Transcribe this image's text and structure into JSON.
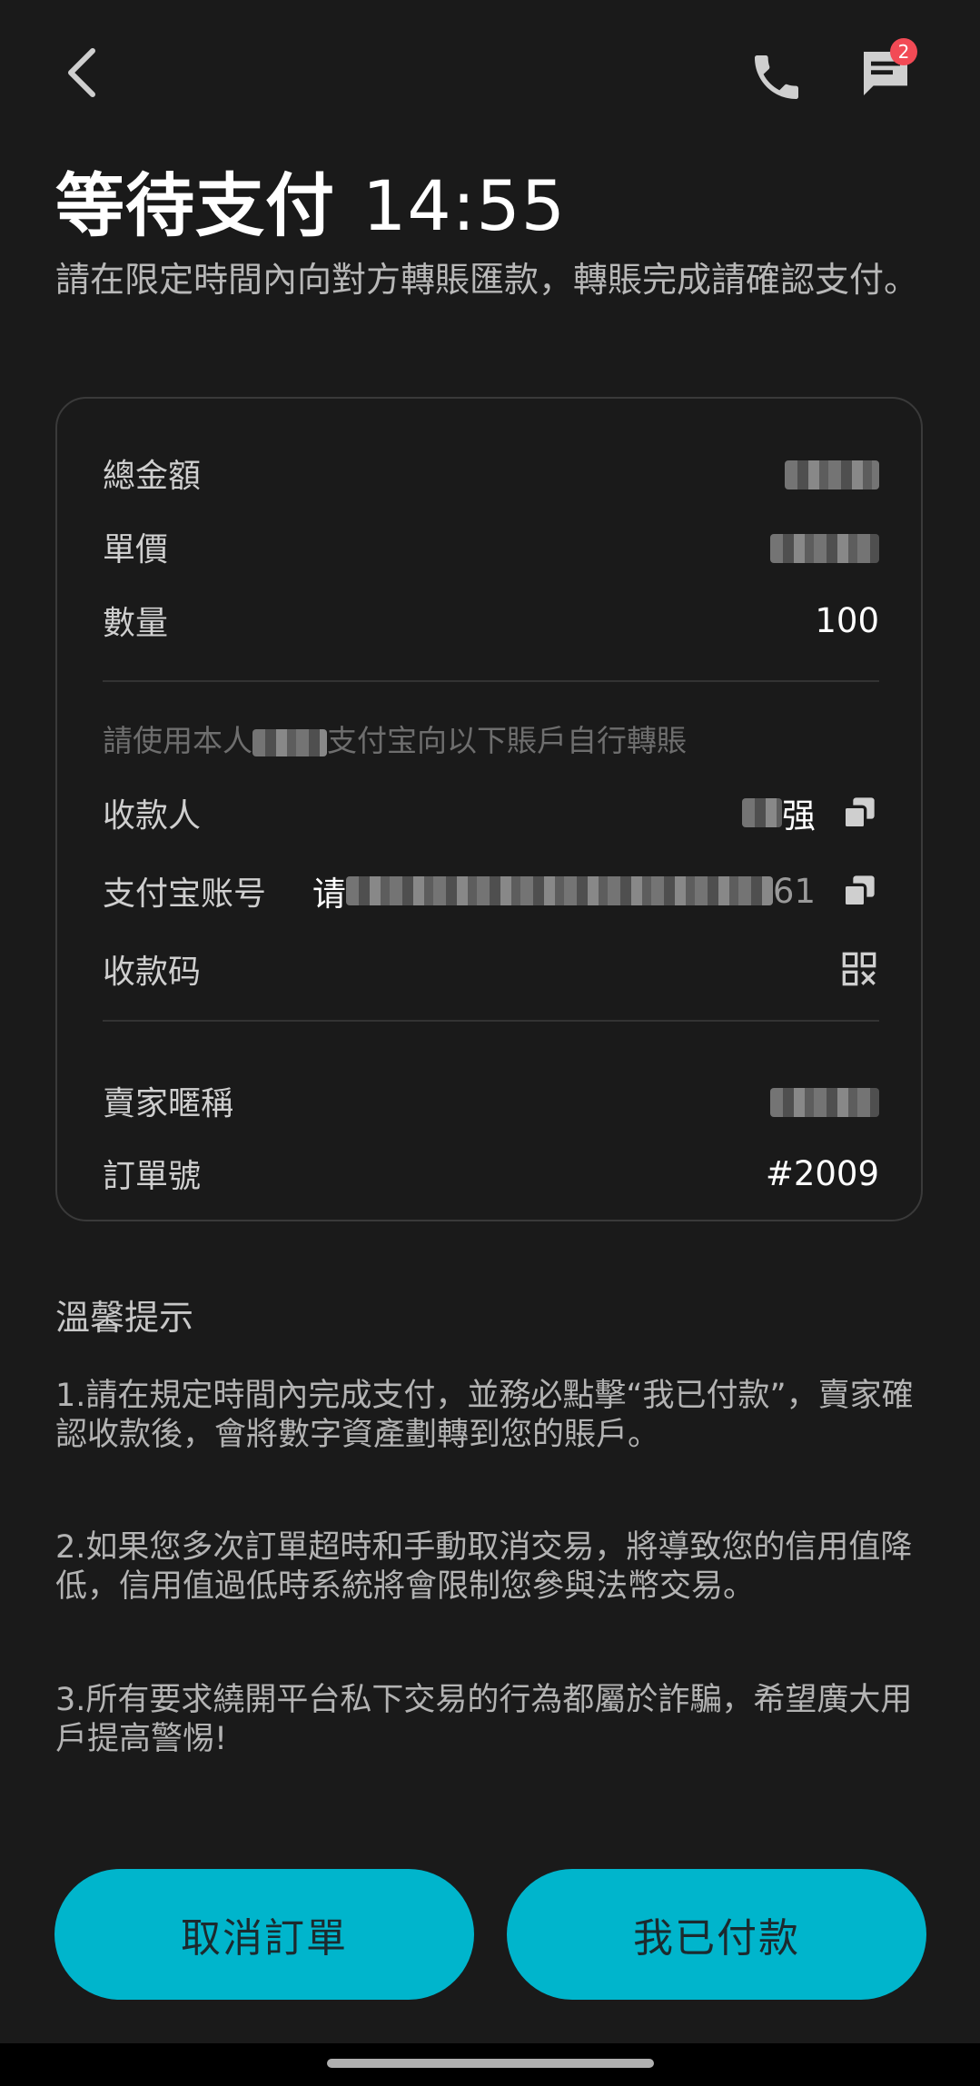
{
  "header": {
    "back_icon": "chevron-left-icon",
    "phone_icon": "phone-icon",
    "chat_icon": "chat-icon",
    "chat_badge": "2"
  },
  "title": {
    "text": "等待支付",
    "timer": "14:55"
  },
  "subtitle": "請在限定時間內向對方轉賬匯款，轉賬完成請確認支付。",
  "order": {
    "total_label": "總金額",
    "unit_price_label": "單價",
    "quantity_label": "數量",
    "quantity_value": "100",
    "pay_hint_prefix": "請使用本人",
    "pay_hint_suffix": "支付宝向以下賬戶自行轉賬",
    "payee_label": "收款人",
    "payee_suffix": "强",
    "account_label": "支付宝账号",
    "account_prefix": "请",
    "account_suffix": "61",
    "qr_label": "收款码",
    "seller_label": "賣家暱稱",
    "order_no_label": "訂單號",
    "order_no_value": "#2009"
  },
  "tips": {
    "title": "溫馨提示",
    "items": [
      "1.請在規定時間內完成支付，並務必點擊“我已付款”，賣家確認收款後，會將數字資產劃轉到您的賬戶。",
      "2.如果您多次訂單超時和手動取消交易，將導致您的信用值降低，信用值過低時系統將會限制您參與法幣交易。",
      "3.所有要求繞開平台私下交易的行為都屬於詐騙，希望廣大用戶提高警惕!"
    ]
  },
  "buttons": {
    "cancel": "取消訂單",
    "paid": "我已付款"
  },
  "colors": {
    "background": "#1a1a1a",
    "accent": "#00b5cc",
    "badge": "#f24a55"
  }
}
